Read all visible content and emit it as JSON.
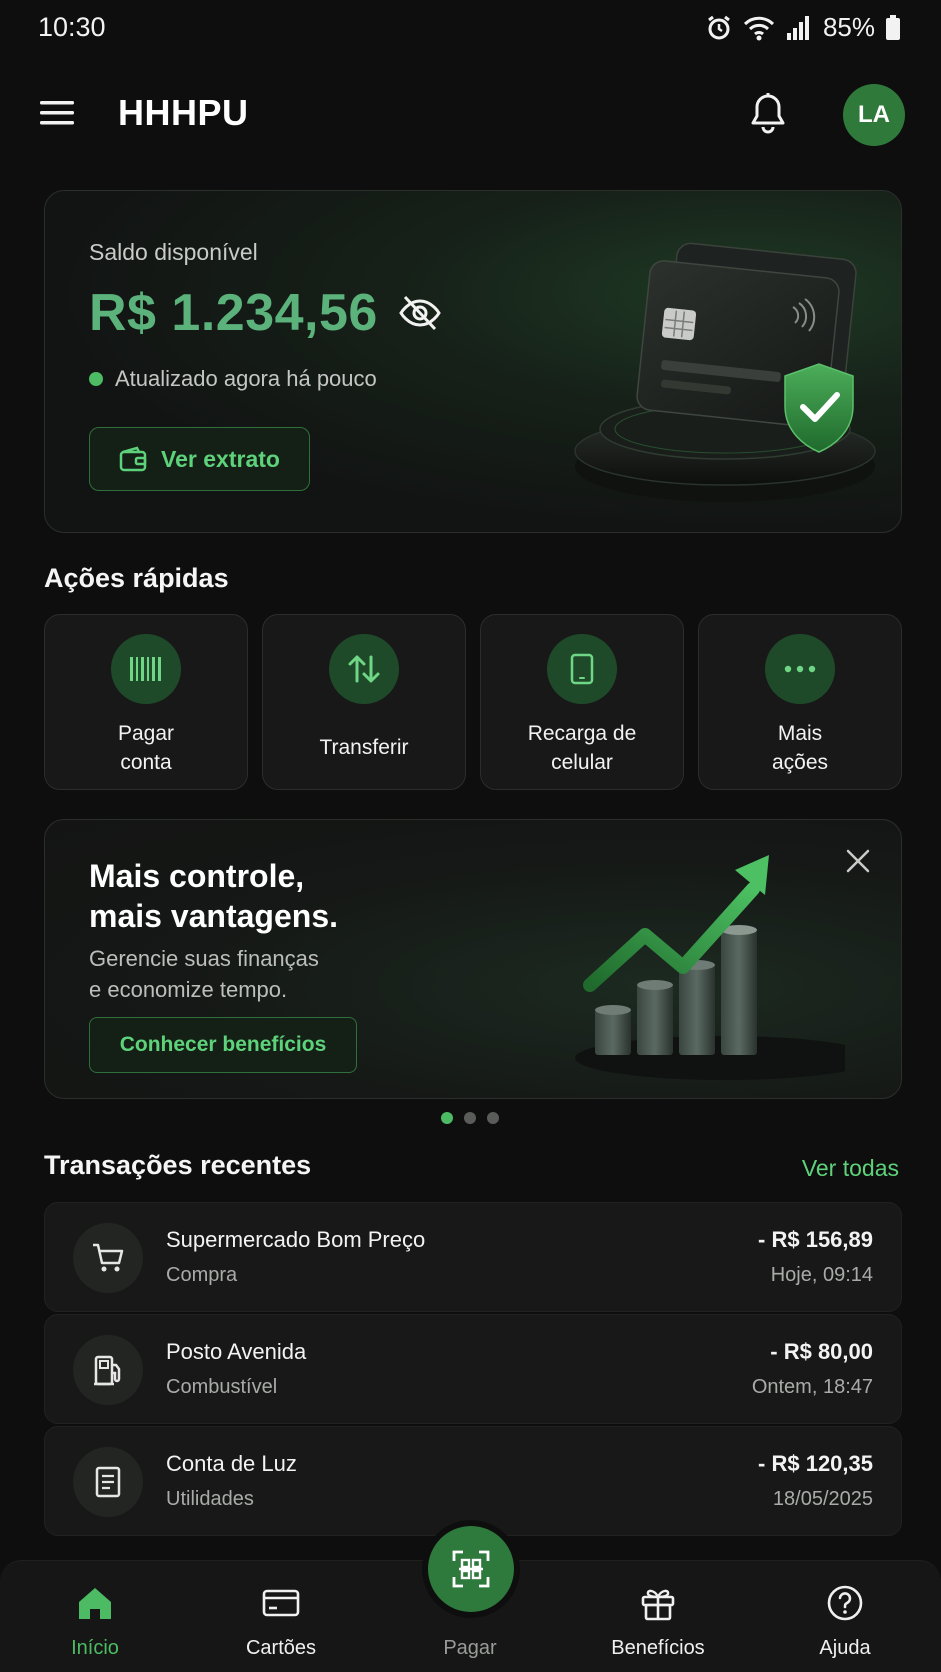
{
  "status_bar": {
    "time": "10:30",
    "battery": "85%"
  },
  "header": {
    "title": "HHHPU",
    "avatar_initials": "LA"
  },
  "balance": {
    "label": "Saldo disponível",
    "amount": "R$ 1.234,56",
    "updated": "Atualizado agora há pouco",
    "extract_button": "Ver extrato"
  },
  "quick_actions": {
    "title": "Ações rápidas",
    "items": [
      {
        "label": "Pagar\nconta",
        "icon": "barcode-icon"
      },
      {
        "label": "Transferir",
        "icon": "transfer-arrows-icon"
      },
      {
        "label": "Recarga de\ncelular",
        "icon": "smartphone-icon"
      },
      {
        "label": "Mais\nações",
        "icon": "more-dots-icon"
      }
    ]
  },
  "promo": {
    "title": "Mais controle,\nmais vantagens.",
    "subtitle": "Gerencie suas finanças\ne economize tempo.",
    "button": "Conhecer benefícios",
    "carousel_active_index": 0,
    "carousel_count": 3
  },
  "transactions": {
    "title": "Transações recentes",
    "see_all": "Ver todas",
    "items": [
      {
        "name": "Supermercado Bom Preço",
        "category": "Compra",
        "amount": "- R$ 156,89",
        "date": "Hoje, 09:14",
        "icon": "cart-icon"
      },
      {
        "name": "Posto Avenida",
        "category": "Combustível",
        "amount": "- R$ 80,00",
        "date": "Ontem, 18:47",
        "icon": "fuel-pump-icon"
      },
      {
        "name": "Conta de Luz",
        "category": "Utilidades",
        "amount": "- R$ 120,35",
        "date": "18/05/2025",
        "icon": "receipt-icon"
      }
    ]
  },
  "bottom_nav": {
    "active": "Início",
    "items": [
      {
        "label": "Início",
        "icon": "home-icon"
      },
      {
        "label": "Cartões",
        "icon": "card-icon"
      },
      {
        "label": "Pagar",
        "icon": "qr-scan-icon"
      },
      {
        "label": "Benefícios",
        "icon": "gift-icon"
      },
      {
        "label": "Ajuda",
        "icon": "help-icon"
      }
    ]
  },
  "colors": {
    "background": "#0e0e0e",
    "accent_green": "#5ed27a",
    "balance_green": "#5bb27b",
    "brand_green": "#2e7a3c"
  }
}
